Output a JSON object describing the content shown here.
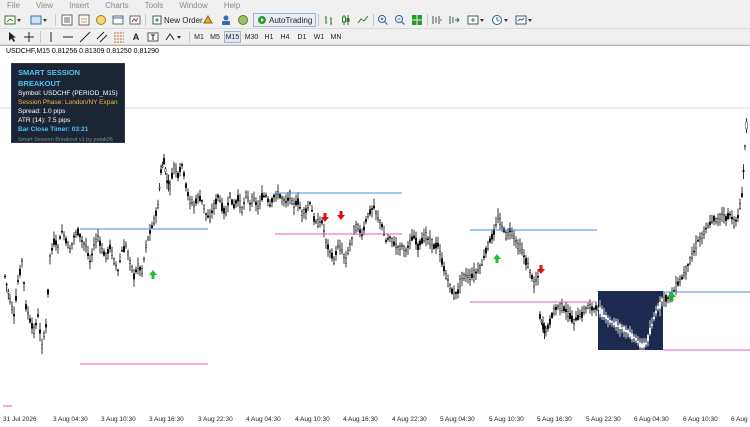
{
  "menu": [
    "File",
    "View",
    "Insert",
    "Charts",
    "Tools",
    "Window",
    "Help"
  ],
  "toolbar": {
    "new_order_label": "New Order",
    "autotrading_label": "AutoTrading"
  },
  "timeframes": [
    "M1",
    "M5",
    "M15",
    "M30",
    "H1",
    "H4",
    "D1",
    "W1",
    "MN"
  ],
  "active_timeframe": "M15",
  "chart": {
    "header": "USDCHF,M15  0.81256 0.81309 0.81250 0.81290",
    "x_ticks": [
      "31 Jul 2026",
      "3 Aug 04:30",
      "3 Aug 10:30",
      "3 Aug 16:30",
      "3 Aug 22:30",
      "4 Aug 04:30",
      "4 Aug 10:30",
      "4 Aug 16:30",
      "4 Aug 22:30",
      "5 Aug 04:30",
      "5 Aug 10:30",
      "5 Aug 16:30",
      "5 Aug 22:30",
      "6 Aug 04:30",
      "6 Aug 10:30",
      "6 Aug"
    ],
    "colors": {
      "candle": "#000000",
      "session_high": "#4a90d9",
      "session_low": "#e05fc0",
      "session_box": "#1b2a4e",
      "arrow_up": "#22bb33",
      "arrow_down": "#dd1111"
    }
  },
  "panel": {
    "title": "SMART SESSION BREAKOUT",
    "symbol": "Symbol: USDCHF (PERIOD_M15)",
    "phase": "Session Phase: London/NY Expansion",
    "spread": "Spread: 1.0 pips",
    "atr": "ATR (14): 7.5 pips",
    "timer": "Bar Close Timer: 03:21",
    "footer": "Smart Session Breakout v1 by palak06"
  }
}
